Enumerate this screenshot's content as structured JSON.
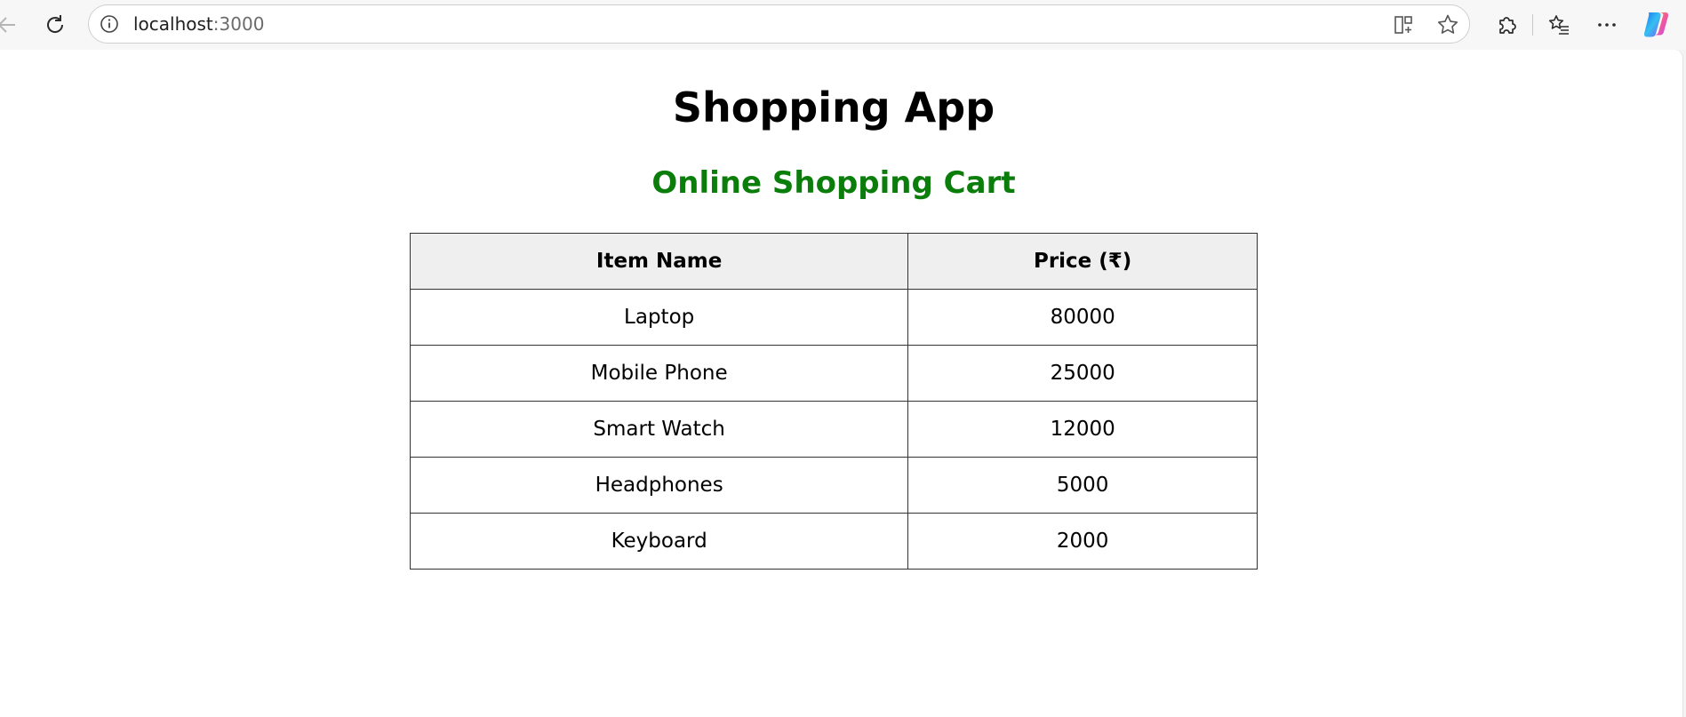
{
  "browser": {
    "url_host": "localhost",
    "url_port": ":3000",
    "icons": {
      "back": "arrow-left-icon",
      "reload": "reload-icon",
      "info": "info-icon",
      "split_screen": "split-screen-icon",
      "favorite": "star-icon",
      "extensions": "puzzle-icon",
      "favorites_list": "favorites-list-icon",
      "menu": "more-icon",
      "copilot": "copilot-icon"
    }
  },
  "page": {
    "title": "Shopping App",
    "subtitle": "Online Shopping Cart",
    "subtitle_color": "#0a7d0a",
    "table": {
      "headers": [
        "Item Name",
        "Price (₹)"
      ],
      "rows": [
        [
          "Laptop",
          "80000"
        ],
        [
          "Mobile Phone",
          "25000"
        ],
        [
          "Smart Watch",
          "12000"
        ],
        [
          "Headphones",
          "5000"
        ],
        [
          "Keyboard",
          "2000"
        ]
      ]
    }
  }
}
